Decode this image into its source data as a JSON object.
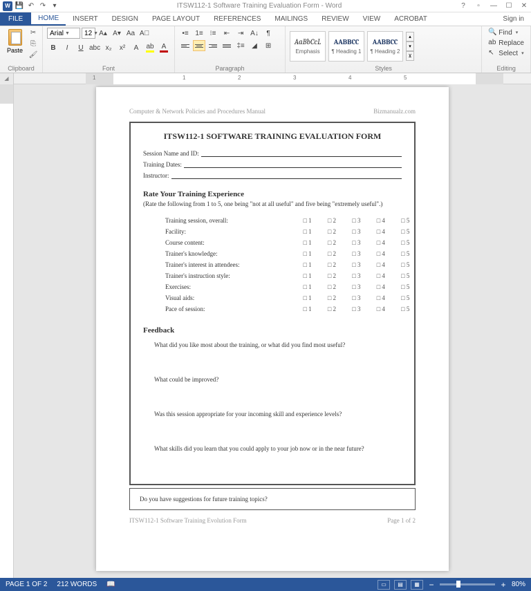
{
  "titlebar": {
    "title": "ITSW112-1 Software Training Evaluation Form - Word",
    "signin": "Sign in"
  },
  "tabs": {
    "file": "FILE",
    "items": [
      "HOME",
      "INSERT",
      "DESIGN",
      "PAGE LAYOUT",
      "REFERENCES",
      "MAILINGS",
      "REVIEW",
      "VIEW",
      "ACROBAT"
    ],
    "active": 0
  },
  "ribbon": {
    "clipboard": {
      "label": "Clipboard",
      "paste": "Paste"
    },
    "font": {
      "label": "Font",
      "name": "Arial",
      "size": "12"
    },
    "paragraph": {
      "label": "Paragraph"
    },
    "styles": {
      "label": "Styles",
      "items": [
        {
          "preview": "AaBbCcL",
          "name": "Emphasis"
        },
        {
          "preview": "AABBCC",
          "name": "¶ Heading 1"
        },
        {
          "preview": "AABBCC",
          "name": "¶ Heading 2"
        }
      ]
    },
    "editing": {
      "label": "Editing",
      "find": "Find",
      "replace": "Replace",
      "select": "Select"
    }
  },
  "doc": {
    "header_left": "Computer & Network Policies and Procedures Manual",
    "header_right": "Bizmanualz.com",
    "title": "ITSW112-1   SOFTWARE TRAINING EVALUATION FORM",
    "fields": [
      "Session Name and ID:",
      "Training Dates:",
      "Instructor:"
    ],
    "rate_head": "Rate Your Training Experience",
    "rate_sub": "(Rate the following from 1 to 5, one being \"not at all useful\" and five being \"extremely useful\".)",
    "rate_items": [
      "Training session, overall:",
      "Facility:",
      "Course content:",
      "Trainer's knowledge:",
      "Trainer's interest in attendees:",
      "Trainer's instruction style:",
      "Exercises:",
      "Visual aids:",
      "Pace of session:"
    ],
    "rate_opts": [
      "□ 1",
      "□ 2",
      "□ 3",
      "□ 4",
      "□ 5"
    ],
    "fb_head": "Feedback",
    "fb_qs": [
      "What did you like most about the training, or what did you find most useful?",
      "What could be improved?",
      "Was this session appropriate for your incoming skill and experience levels?",
      "What skills did you learn that you could apply to your job now or in the near future?"
    ],
    "suggest": "Do you have suggestions for future training topics?",
    "footer_left": "ITSW112-1 Software Training Evolution Form",
    "footer_right": "Page 1 of 2"
  },
  "status": {
    "page": "PAGE 1 OF 2",
    "words": "212 WORDS",
    "zoom": "80%"
  },
  "ruler_nums": [
    "1",
    "1",
    "2",
    "3",
    "4",
    "5"
  ]
}
